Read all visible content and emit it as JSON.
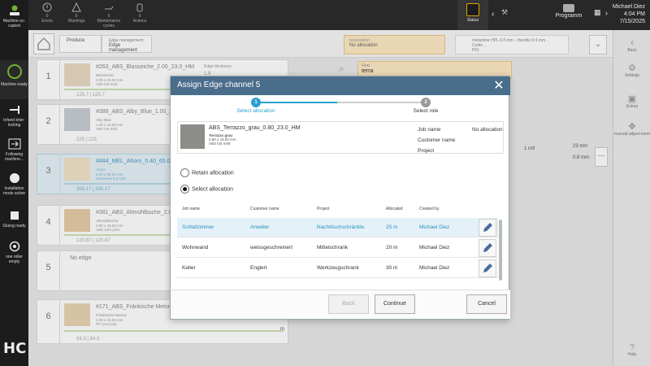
{
  "topbar": {
    "stats": [
      {
        "count": "0",
        "label": "Errors"
      },
      {
        "count": "0",
        "label": "Warnings"
      },
      {
        "count": "0",
        "label": "Maintenance cycles"
      },
      {
        "count": "0",
        "label": "Actions"
      }
    ],
    "status_label": "Status",
    "program_label": "Programm",
    "user": "Michael Diez",
    "time": "4:04 PM",
    "date": "7/15/2025"
  },
  "leftbar": {
    "items": [
      "Machine oc-cupied",
      "Machine ready",
      "Infeed inter-locking",
      "Following machine...",
      "Installation mode active",
      "Gluing ready",
      "one roller empty"
    ],
    "logo_text": "HC"
  },
  "rightbar": {
    "items": [
      "Back",
      "Settings",
      "Extras",
      "manual adjust-ment",
      "Help"
    ]
  },
  "breadcrumb": {
    "produce": "Produce",
    "edge_parent": "Edge management",
    "edge_current": "Edge management",
    "reservation_label": "reservation",
    "reservation_value": "No allocation",
    "search_label": "Find",
    "search_value": "terra"
  },
  "list": [
    {
      "num": "1",
      "title": "#263_ABS_Blasseiche_2.00_23.0_HM",
      "meta": [
        "Blasseiche",
        "2.00 x 23.00 mm",
        "ABS hot melt"
      ],
      "foot": "125.7 | 125.7",
      "edge_thickness_label": "Edge thickness",
      "edge_thickness": "1.9",
      "thumb": "#e8d8c0"
    },
    {
      "num": "2",
      "title": "#388_ABS_Alby_Blue_1.00_23.0_...",
      "meta": [
        "Alby Blue",
        "1.00 x 23.00 mm",
        "ABS hot melt"
      ],
      "foot": "225 | 225",
      "thumb": "#c8ccd4"
    },
    {
      "num": "3",
      "title": "#484_MEL_Ahorn_0.40_65.0_HM",
      "meta": [
        "Ahorn",
        "0.40 x 65.00 mm",
        "melamine hot melt"
      ],
      "foot": "358.17 | 358.17",
      "thumb": "#f0e3c8"
    },
    {
      "num": "4",
      "title": "#381_ABS_Altmühlbuche_2.00_23...",
      "meta": [
        "Altmühlbuche",
        "2.00 x 23.00 mm",
        "ABS zero-joint"
      ],
      "foot": "120.87 | 120.87",
      "thumb": "#e6cba8"
    },
    {
      "num": "5",
      "title": "No edge",
      "meta": [],
      "foot": "",
      "thumb": ""
    },
    {
      "num": "6",
      "title": "#171_ABS_Fränkische Melone_2...",
      "meta": [
        "Fränkische Melone",
        "2.00 x 23.00 mm",
        "PP zero-joint"
      ],
      "foot": "54.3 | 54.3",
      "thumb": "#e9d3b4"
    }
  ],
  "side_info": {
    "roll": "1 roll",
    "width": "23 mm",
    "thickness": "0.8 mm",
    "unit_m": "m",
    "material_hint": "melamine HPL 0.4 mm · chenille 0.4 mm · Cuttin...",
    "material_code": "P01"
  },
  "dialog": {
    "title": "Assign Edge channel 5",
    "step1_num": "1",
    "step1_label": "Select allocation",
    "step2_num": "2",
    "step2_label": "Select role",
    "edge_name": "ABS_Terrazzo_grau_0.80_23.0_HM",
    "edge_meta1": "Terrazzo grau",
    "edge_meta2": "0.80 x 23.00 mm",
    "edge_meta3": "ABS hot melt",
    "job_name_label": "Job name",
    "job_name_value": "No allocation",
    "customer_name_label": "Customer name",
    "project_label": "Project",
    "radio_retain": "Retain allocation",
    "radio_select": "Select allocation",
    "columns": [
      "Job name",
      "Customer name",
      "Project",
      "Allocated",
      "Created by"
    ],
    "rows": [
      {
        "job": "Schlafzimmer",
        "customer": "Arweiler",
        "project": "Nachttischschränkle",
        "allocated": "25 m",
        "created_by": "Michael Diez"
      },
      {
        "job": "Wohnwand",
        "customer": "weissgeschreinert",
        "project": "Mittelschrank",
        "allocated": "20 m",
        "created_by": "Michael Diez"
      },
      {
        "job": "Keller",
        "customer": "Englert",
        "project": "Werkzeugschrank",
        "allocated": "30 m",
        "created_by": "Michael Diez"
      }
    ],
    "btn_back": "Back",
    "btn_continue": "Continue",
    "btn_cancel": "Cancel"
  },
  "colors": {
    "accent": "#2a9fd0",
    "header": "#4a6d8c",
    "status_border": "#f0b400",
    "reservation_bg": "#fde9c4"
  }
}
